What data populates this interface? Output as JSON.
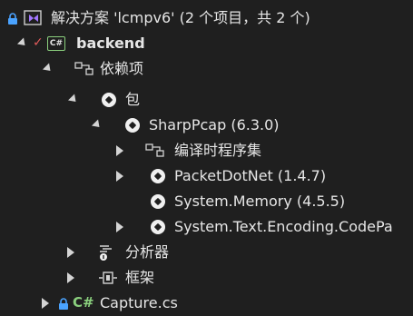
{
  "tree": {
    "solution_label": "解决方案 'lcmpv6' (2 个项目，共 2 个)",
    "project_label": "backend",
    "dependencies_label": "依赖项",
    "packages_label": "包",
    "sharppcap_label": "SharpPcap (6.3.0)",
    "compiletime_label": "编译时程序集",
    "packetdotnet_label": "PacketDotNet (1.4.7)",
    "sysmemory_label": "System.Memory (4.5.5)",
    "textencoding_label": "System.Text.Encoding.CodePa",
    "analyzers_label": "分析器",
    "frameworks_label": "框架",
    "capture_label": "Capture.cs"
  },
  "icons": {
    "lock": "lock-icon",
    "solution": "solution-icon",
    "project": "csharp-project-icon",
    "dependencies": "dependencies-icon",
    "package": "nuget-package-icon",
    "analyzer": "analyzer-icon",
    "framework": "framework-icon",
    "csfile": "csharp-file-icon"
  },
  "colors": {
    "background": "#1f1f1f",
    "text": "#e6e6e6",
    "lock": "#4aa3ff",
    "check": "#e05a5a",
    "vs_purple": "#a277ff",
    "cs_green": "#8bd07e"
  }
}
